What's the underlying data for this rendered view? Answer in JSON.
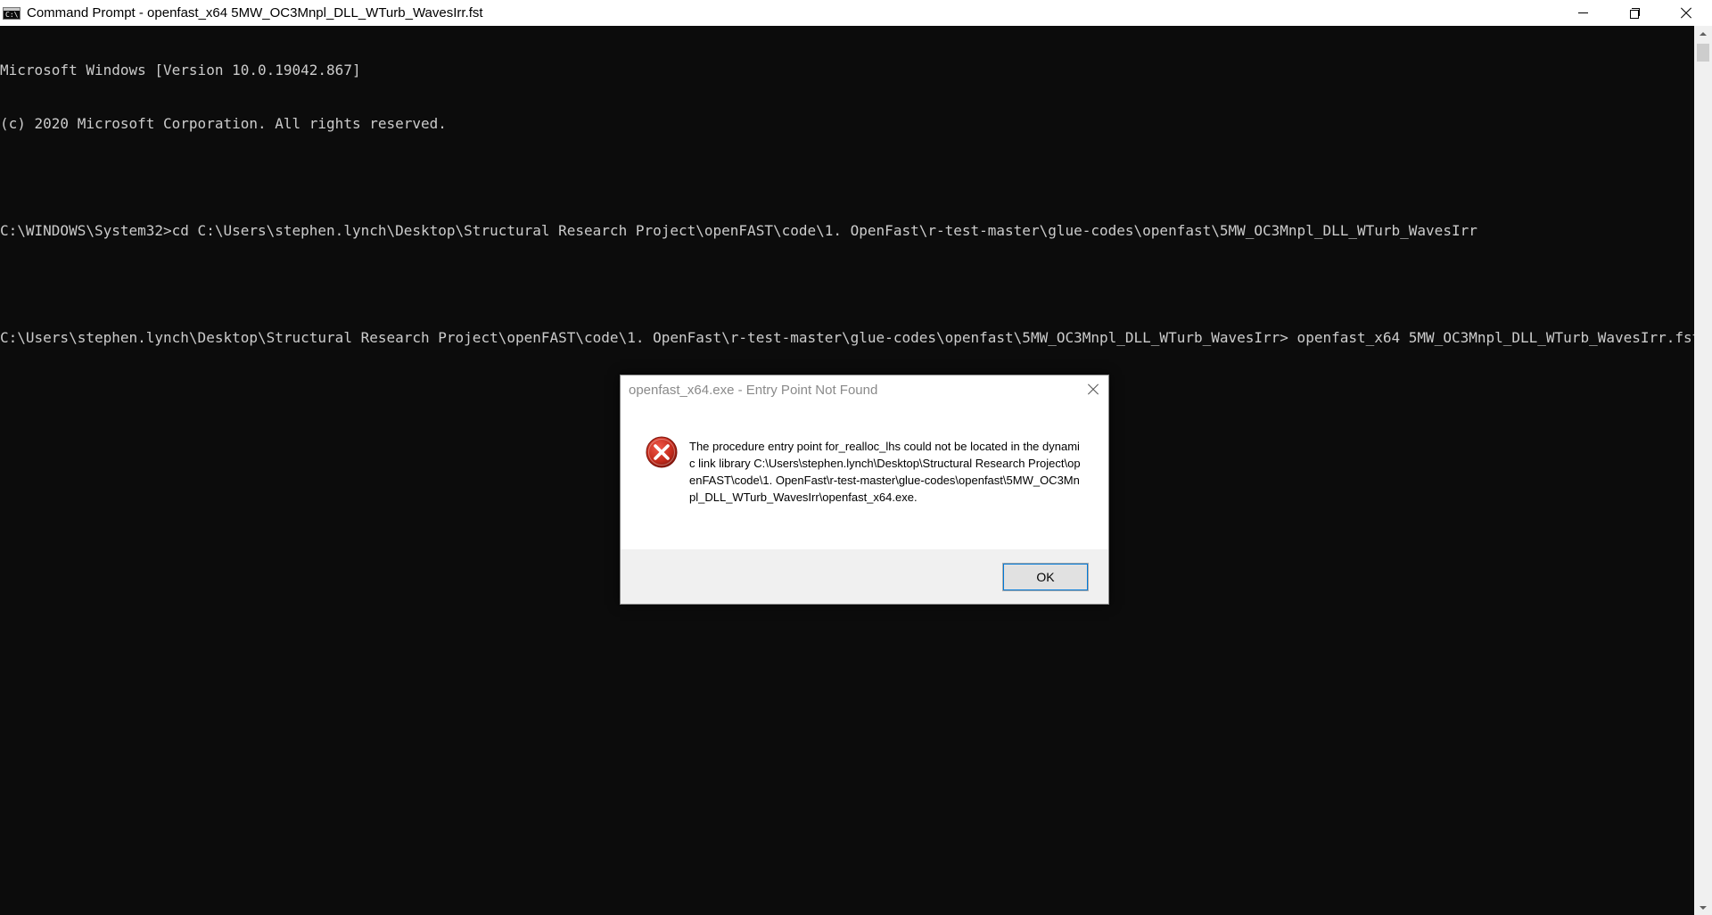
{
  "window": {
    "title": "Command Prompt - openfast_x64  5MW_OC3Mnpl_DLL_WTurb_WavesIrr.fst",
    "icon": "cmd-icon",
    "icon_text": "C:\\"
  },
  "console": {
    "lines": [
      "Microsoft Windows [Version 10.0.19042.867]",
      "(c) 2020 Microsoft Corporation. All rights reserved.",
      "",
      "C:\\WINDOWS\\System32>cd C:\\Users\\stephen.lynch\\Desktop\\Structural Research Project\\openFAST\\code\\1. OpenFast\\r-test-master\\glue-codes\\openfast\\5MW_OC3Mnpl_DLL_WTurb_WavesIrr",
      "",
      "C:\\Users\\stephen.lynch\\Desktop\\Structural Research Project\\openFAST\\code\\1. OpenFast\\r-test-master\\glue-codes\\openfast\\5MW_OC3Mnpl_DLL_WTurb_WavesIrr> openfast_x64 5MW_OC3Mnpl_DLL_WTurb_WavesIrr.fst"
    ]
  },
  "dialog": {
    "title": "openfast_x64.exe - Entry Point Not Found",
    "message": "The procedure entry point for_realloc_lhs could not be located in the dynamic link library C:\\Users\\stephen.lynch\\Desktop\\Structural Research Project\\openFAST\\code\\1. OpenFast\\r-test-master\\glue-codes\\openfast\\5MW_OC3Mnpl_DLL_WTurb_WavesIrr\\openfast_x64.exe.",
    "ok_label": "OK",
    "icon": "error-icon"
  },
  "colors": {
    "console_bg": "#0c0c0c",
    "console_text": "#cccccc",
    "error_red": "#c42b1c"
  }
}
